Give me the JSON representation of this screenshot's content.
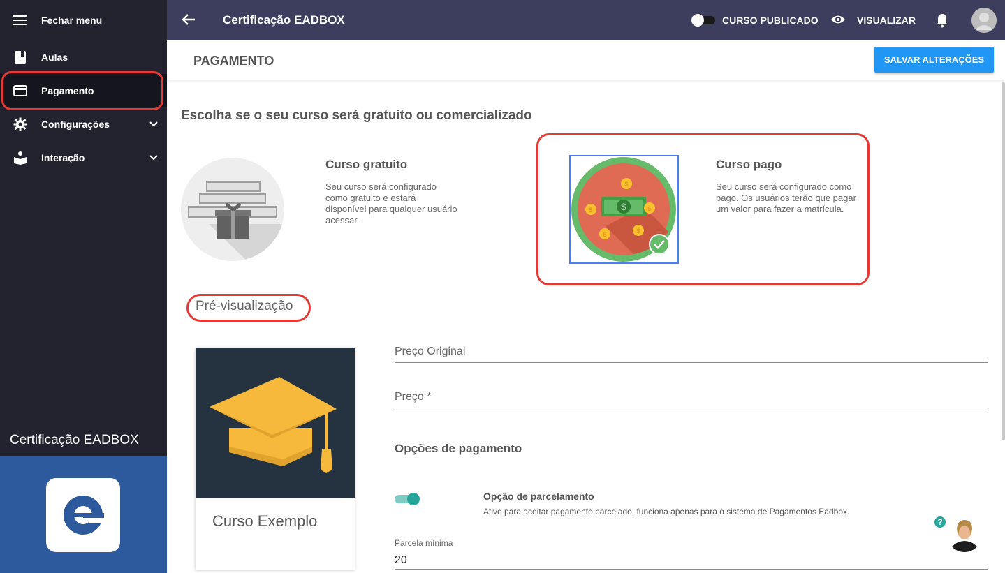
{
  "sidebar": {
    "close_menu": "Fechar menu",
    "items": [
      {
        "label": "Aulas",
        "icon": "book-icon"
      },
      {
        "label": "Pagamento",
        "icon": "credit-card-icon"
      },
      {
        "label": "Configurações",
        "icon": "gear-icon"
      },
      {
        "label": "Interação",
        "icon": "reader-icon"
      }
    ],
    "brand": "Certificação EADBOX"
  },
  "topbar": {
    "title": "Certificação EADBOX",
    "published_label": "CURSO PUBLICADO",
    "view_label": "VISUALIZAR"
  },
  "header": {
    "title": "PAGAMENTO",
    "save_label": "SALVAR ALTERAÇÕES"
  },
  "main": {
    "choose_heading": "Escolha se o seu curso será gratuito ou comercializado",
    "free": {
      "title": "Curso gratuito",
      "desc": "Seu curso será configurado como gratuito e estará disponível para qualquer usuário acessar."
    },
    "paid": {
      "title": "Curso pago",
      "desc": "Seu curso será configurado como pago. Os usuários terão que pagar um valor para fazer a matrícula."
    },
    "preview_title": "Pré-visualização",
    "course_name": "Curso Exemplo",
    "fields": {
      "original_price_label": "Preço Original",
      "price_label": "Preço *"
    },
    "payment_options": "Opções de pagamento",
    "installment": {
      "title": "Opção de parcelamento",
      "desc": "Ative para aceitar pagamento parcelado. funciona apenas para o sistema de Pagamentos Eadbox.",
      "enabled": true
    },
    "min_installment_label": "Parcela mínima",
    "min_installment_value": "20",
    "help": "?"
  },
  "colors": {
    "sidebar_bg": "#23222f",
    "topbar_bg": "#3d3d5e",
    "primary_button": "#2196f3",
    "highlight": "#e53935",
    "switch_on": "#26a69a",
    "logo_panel": "#2c5a9c"
  }
}
